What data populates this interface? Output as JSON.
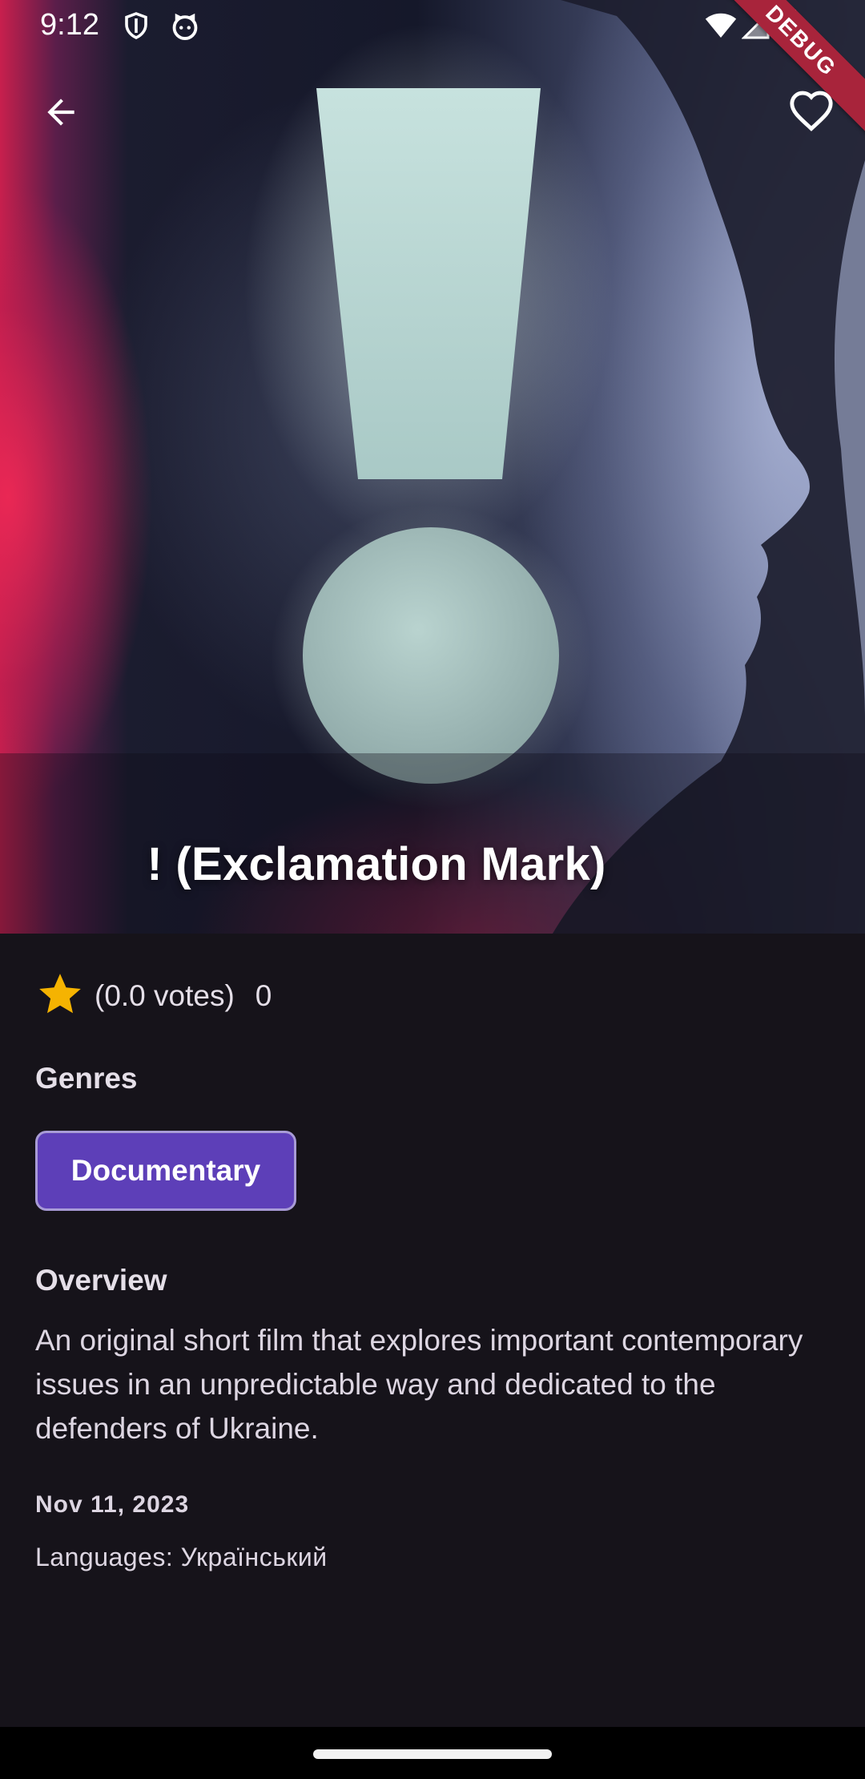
{
  "status_bar": {
    "time": "9:12",
    "icons_left": [
      "shield-icon",
      "cat-face-icon"
    ],
    "icons_right": [
      "wifi-icon",
      "signal-icon",
      "battery-icon"
    ]
  },
  "debug_banner": "DEBUG",
  "header": {
    "back_icon": "arrow-left-icon",
    "favorite_icon": "heart-outline-icon"
  },
  "movie": {
    "title": "! (Exclamation Mark)",
    "rating": {
      "star_icon": "star-icon",
      "votes_text": "(0.0 votes)",
      "count_text": "0"
    },
    "genres_title": "Genres",
    "genres": [
      "Documentary"
    ],
    "overview_title": "Overview",
    "overview": "An original short film that explores important contemporary issues in an unpredictable way and dedicated to the defenders of Ukraine.",
    "release_date": "Nov 11, 2023",
    "languages": "Languages: Український"
  },
  "colors": {
    "background": "#16131a",
    "chip_fill": "#5d3fb8",
    "chip_border": "#a89bd6",
    "star": "#f5b301",
    "debug_banner": "#a8243b"
  }
}
